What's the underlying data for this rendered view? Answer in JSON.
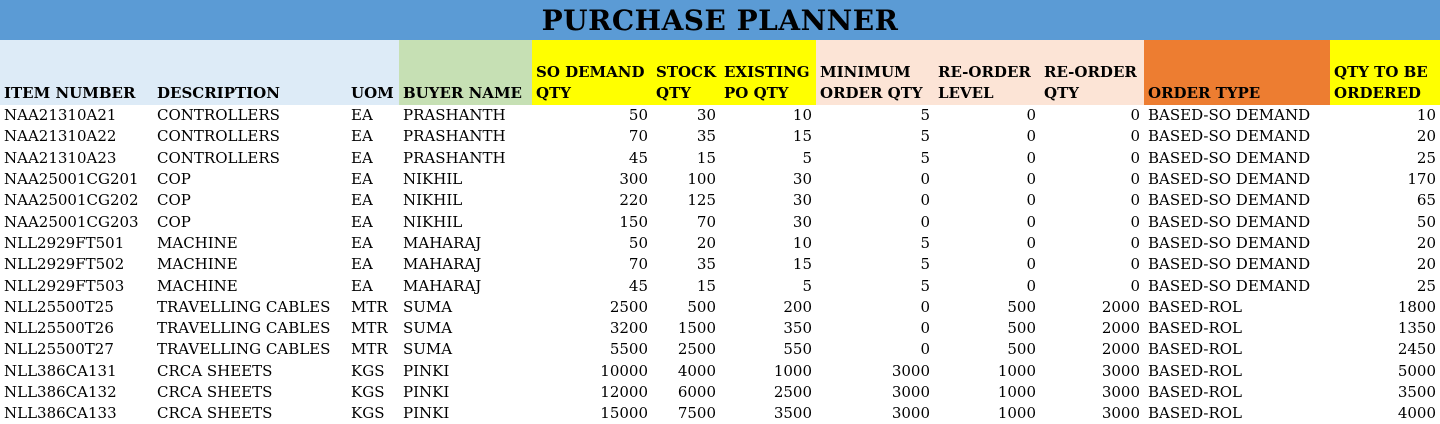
{
  "title": "PURCHASE PLANNER",
  "columns": [
    "ITEM NUMBER",
    "DESCRIPTION",
    "UOM",
    "BUYER NAME",
    "SO DEMAND QTY",
    "STOCK QTY",
    "EXISTING PO QTY",
    "MINIMUM ORDER QTY",
    "RE-ORDER LEVEL",
    "RE-ORDER QTY",
    "ORDER TYPE",
    "QTY TO BE ORDERED"
  ],
  "header_colors": {
    "light_blue": "#ddebf7",
    "green": "#c6e0b4",
    "yellow": "#ffff00",
    "peach": "#fce4d6",
    "orange": "#ed7d31",
    "title_blue": "#5b9bd5"
  },
  "rows": [
    [
      "NAA21310A21",
      "CONTROLLERS",
      "EA",
      "PRASHANTH",
      "50",
      "30",
      "10",
      "5",
      "0",
      "0",
      "BASED-SO DEMAND",
      "10"
    ],
    [
      "NAA21310A22",
      "CONTROLLERS",
      "EA",
      "PRASHANTH",
      "70",
      "35",
      "15",
      "5",
      "0",
      "0",
      "BASED-SO DEMAND",
      "20"
    ],
    [
      "NAA21310A23",
      "CONTROLLERS",
      "EA",
      "PRASHANTH",
      "45",
      "15",
      "5",
      "5",
      "0",
      "0",
      "BASED-SO DEMAND",
      "25"
    ],
    [
      "NAA25001CG201",
      "COP",
      "EA",
      "NIKHIL",
      "300",
      "100",
      "30",
      "0",
      "0",
      "0",
      "BASED-SO DEMAND",
      "170"
    ],
    [
      "NAA25001CG202",
      "COP",
      "EA",
      "NIKHIL",
      "220",
      "125",
      "30",
      "0",
      "0",
      "0",
      "BASED-SO DEMAND",
      "65"
    ],
    [
      "NAA25001CG203",
      "COP",
      "EA",
      "NIKHIL",
      "150",
      "70",
      "30",
      "0",
      "0",
      "0",
      "BASED-SO DEMAND",
      "50"
    ],
    [
      "NLL2929FT501",
      "MACHINE",
      "EA",
      "MAHARAJ",
      "50",
      "20",
      "10",
      "5",
      "0",
      "0",
      "BASED-SO DEMAND",
      "20"
    ],
    [
      "NLL2929FT502",
      "MACHINE",
      "EA",
      "MAHARAJ",
      "70",
      "35",
      "15",
      "5",
      "0",
      "0",
      "BASED-SO DEMAND",
      "20"
    ],
    [
      "NLL2929FT503",
      "MACHINE",
      "EA",
      "MAHARAJ",
      "45",
      "15",
      "5",
      "5",
      "0",
      "0",
      "BASED-SO DEMAND",
      "25"
    ],
    [
      "NLL25500T25",
      "TRAVELLING CABLES",
      "MTR",
      "SUMA",
      "2500",
      "500",
      "200",
      "0",
      "500",
      "2000",
      "BASED-ROL",
      "1800"
    ],
    [
      "NLL25500T26",
      "TRAVELLING CABLES",
      "MTR",
      "SUMA",
      "3200",
      "1500",
      "350",
      "0",
      "500",
      "2000",
      "BASED-ROL",
      "1350"
    ],
    [
      "NLL25500T27",
      "TRAVELLING CABLES",
      "MTR",
      "SUMA",
      "5500",
      "2500",
      "550",
      "0",
      "500",
      "2000",
      "BASED-ROL",
      "2450"
    ],
    [
      "NLL386CA131",
      "CRCA SHEETS",
      "KGS",
      "PINKI",
      "10000",
      "4000",
      "1000",
      "3000",
      "1000",
      "3000",
      "BASED-ROL",
      "5000"
    ],
    [
      "NLL386CA132",
      "CRCA SHEETS",
      "KGS",
      "PINKI",
      "12000",
      "6000",
      "2500",
      "3000",
      "1000",
      "3000",
      "BASED-ROL",
      "3500"
    ],
    [
      "NLL386CA133",
      "CRCA SHEETS",
      "KGS",
      "PINKI",
      "15000",
      "7500",
      "3500",
      "3000",
      "1000",
      "3000",
      "BASED-ROL",
      "4000"
    ]
  ]
}
